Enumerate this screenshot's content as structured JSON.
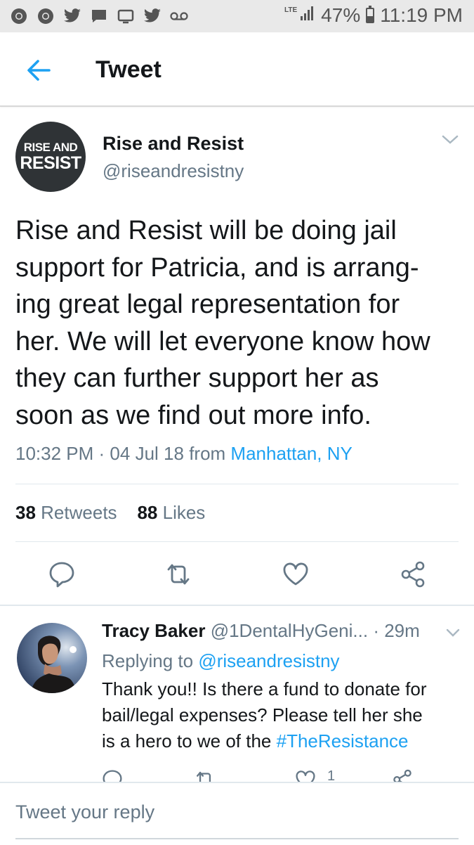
{
  "status_bar": {
    "left_icons": [
      "chrome-icon",
      "chrome-icon",
      "twitter-bird-icon",
      "message-icon",
      "cast-icon",
      "twitter-bird-icon",
      "voicemail-icon"
    ],
    "network": "LTE",
    "battery_percent": "47%",
    "battery_level": 0.47,
    "time": "11:19 PM"
  },
  "header": {
    "title": "Tweet",
    "back_icon": "arrow-left-icon",
    "accent_color": "#1da1f2"
  },
  "tweet": {
    "avatar_line1": "RISE AND",
    "avatar_line2": "RESIST",
    "name": "Rise and Resist",
    "handle": "@riseandresistny",
    "text_lines": [
      "Rise and Resist will be doing jail",
      "support for Patricia, and is arrang-",
      "ing great legal representation for",
      "her. We will let everyone know how",
      "they can further support her as",
      "soon as we find out more info."
    ],
    "time": "10:32 PM",
    "date": "04 Jul 18",
    "from_label": "from",
    "location": "Manhattan, NY",
    "retweets_count": "38",
    "retweets_label": "Retweets",
    "likes_count": "88",
    "likes_label": "Likes"
  },
  "reply": {
    "name": "Tracy Baker",
    "handle": "@1DentalHyGeni...",
    "age": "· 29m",
    "replying_label": "Replying to",
    "replying_to": "@riseandresistny",
    "text_lines": [
      "Thank you!! Is there a fund to donate for",
      "bail/legal expenses? Please tell her she"
    ],
    "text_line3": "is a hero to we of the",
    "hashtag": "#TheResistance",
    "like_count": "1"
  },
  "compose": {
    "placeholder": "Tweet your reply"
  }
}
